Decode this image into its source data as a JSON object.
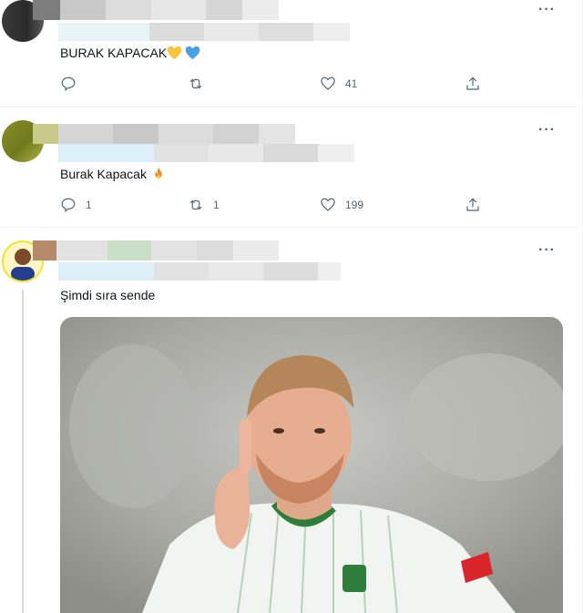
{
  "tweets": [
    {
      "text": "BURAK KAPACAK",
      "emojis": [
        "yellow-heart",
        "blue-heart"
      ],
      "counts": {
        "reply": "",
        "retweet": "",
        "like": "41"
      }
    },
    {
      "text": "Burak Kapacak",
      "emojis": [
        "fire"
      ],
      "counts": {
        "reply": "1",
        "retweet": "1",
        "like": "199"
      }
    },
    {
      "text": "Şimdi sıra sende",
      "image": "football-player-shush-gesture"
    }
  ],
  "more_label": "···",
  "colors": {
    "icon": "#536471",
    "divider": "#eff3f4",
    "thread": "#cfd9de"
  }
}
